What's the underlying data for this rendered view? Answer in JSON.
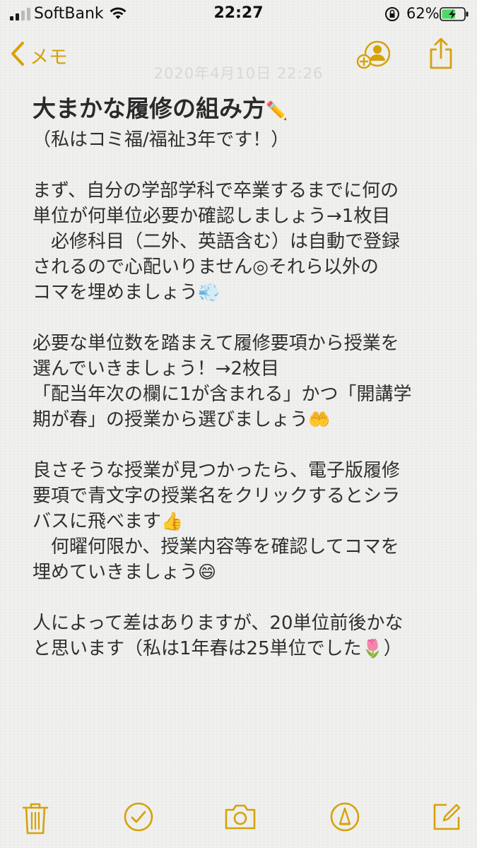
{
  "status_bar": {
    "carrier": "SoftBank",
    "time": "22:27",
    "battery_percent": "62%",
    "battery_level": 0.62
  },
  "nav": {
    "back_label": "メモ"
  },
  "note": {
    "date": "2020年4月10日 22:26",
    "title": "大まかな履修の組み方",
    "lines": [
      "（私はコミ福/福祉3年です！）",
      "",
      "まず、自分の学部学科で卒業するまでに何の",
      "単位が何単位必要か確認しましょう→1枚目",
      "　必修科目（二外、英語含む）は自動で登録",
      "されるので心配いりません◎それら以外の",
      "コマを埋めましょう",
      "",
      "必要な単位数を踏まえて履修要項から授業を",
      "選んでいきましょう！→2枚目",
      "「配当年次の欄に1が含まれる」かつ「開講学",
      "期が春」の授業から選びましょう",
      "",
      "良さそうな授業が見つかったら、電子版履修",
      "要項で青文字の授業名をクリックするとシラ",
      "バスに飛べます",
      "　何曜何限か、授業内容等を確認してコマを",
      "埋めていきましょう",
      "",
      "人によって差はありますが、20単位前後かな",
      "と思います（私は1年春は25単位でした",
      "）"
    ]
  },
  "colors": {
    "accent": "#d5a20a",
    "background": "#f1f1ef",
    "text": "#2f2f2f"
  },
  "icons": {
    "title_emoji": "pencil",
    "line6_emoji": "dash",
    "line11_emoji": "palms-up",
    "line15_emoji": "thumbs-up",
    "line17_emoji": "grinning-face",
    "line20_emoji": "tulip"
  }
}
